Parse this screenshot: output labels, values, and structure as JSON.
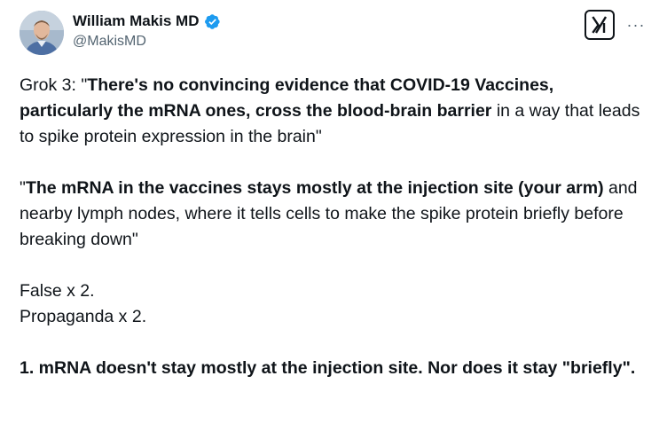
{
  "author": {
    "display_name": "William Makis MD",
    "handle": "@MakisMD",
    "verified": true,
    "badge_color": "#1d9bf0"
  },
  "actions": {
    "grok_icon": "grok-logo-icon",
    "more_icon": "more-options-icon",
    "more_label": "···"
  },
  "tweet": {
    "p1": {
      "prefix": "Grok 3: \"",
      "bold": "There's no convincing evidence that COVID-19 Vaccines, particularly the mRNA ones, cross the blood-brain barrier",
      "rest": " in a way that leads to spike protein expression in the brain\""
    },
    "p2": {
      "prefix": "\"",
      "bold": "The mRNA in the vaccines stays mostly at the injection site (your arm)",
      "rest": " and nearby lymph nodes, where it tells cells to make the spike protein briefly before breaking down\""
    },
    "p3_line1": "False x 2.",
    "p3_line2": "Propaganda x 2.",
    "p4_bold": "1. mRNA doesn't stay mostly at the injection site. Nor does it stay \"briefly\"."
  }
}
